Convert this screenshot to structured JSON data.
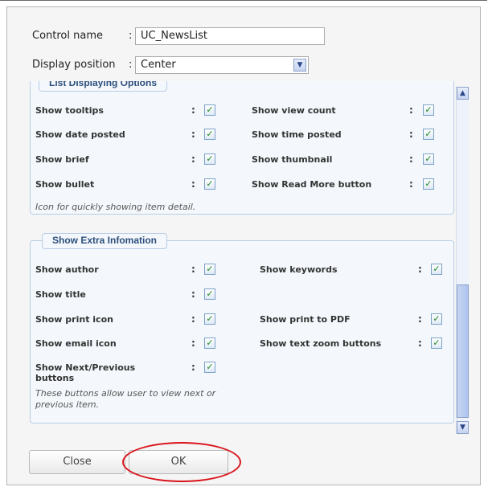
{
  "form": {
    "control_name_label": "Control name",
    "control_name_value": "UC_NewsList",
    "display_position_label": "Display position",
    "display_position_value": "Center",
    "colon": ":"
  },
  "list_section": {
    "legend": "List Displaying Options",
    "options": [
      {
        "label": "Show tooltips",
        "checked": true
      },
      {
        "label": "Show view count",
        "checked": true
      },
      {
        "label": "Show date posted",
        "checked": true
      },
      {
        "label": "Show time posted",
        "checked": true
      },
      {
        "label": "Show brief",
        "checked": true
      },
      {
        "label": "Show thumbnail",
        "checked": true
      },
      {
        "label": "Show bullet",
        "checked": true
      },
      {
        "label": "Show Read More button",
        "checked": true
      }
    ],
    "note": "Icon for quickly showing item detail."
  },
  "extra_section": {
    "legend": "Show Extra Infomation",
    "options": [
      {
        "label": "Show author",
        "checked": true
      },
      {
        "label": "Show keywords",
        "checked": true
      },
      {
        "label": "Show title",
        "checked": true
      },
      {
        "label": "Show print icon",
        "checked": true
      },
      {
        "label": "Show print to PDF",
        "checked": true
      },
      {
        "label": "Show email icon",
        "checked": true
      },
      {
        "label": "Show text zoom buttons",
        "checked": true
      },
      {
        "label": "Show Next/Previous buttons",
        "checked": true
      }
    ],
    "note": "These buttons allow user to view next or previous item."
  },
  "check_glyph": "✓",
  "buttons": {
    "close": "Close",
    "ok": "OK"
  },
  "colors": {
    "legend_text": "#2c4f7c",
    "group_border": "#b9cde6",
    "highlight_ring": "#d9141b"
  }
}
